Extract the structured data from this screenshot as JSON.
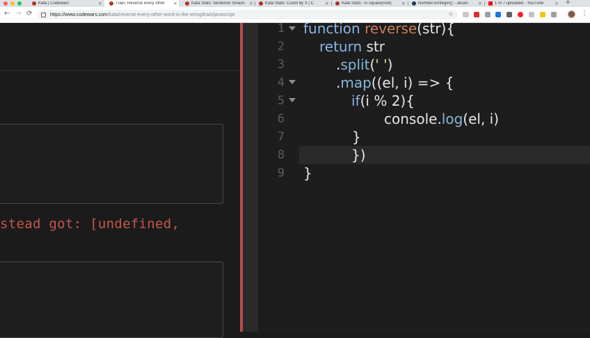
{
  "browser": {
    "tabs": [
      {
        "title": "Kata | Codewars",
        "active": false,
        "favicon_color": "#b1361e"
      },
      {
        "title": "Train: Reverse every other",
        "active": true,
        "favicon_color": "#b1361e"
      },
      {
        "title": "Kata Stats: Sentence Smash",
        "active": false,
        "favicon_color": "#b1361e"
      },
      {
        "title": "Kata Stats: Count by X | C",
        "active": false,
        "favicon_color": "#b1361e"
      },
      {
        "title": "Kata Stats: To square(root)",
        "active": false,
        "favicon_color": "#b1361e"
      },
      {
        "title": "Number.isInteger() - JavaS",
        "active": false,
        "favicon_color": "#1f3a56"
      },
      {
        "title": "1 of 7 uploaded - YouTube",
        "active": false,
        "favicon_color": "#ff0000"
      }
    ],
    "tab_close_glyph": "×",
    "new_tab_glyph": "+",
    "back_glyph": "←",
    "forward_glyph": "→",
    "reload_glyph": "⟳",
    "url_host": "https://www.codewars.com",
    "url_path": "/kata/reverse-every-other-word-in-the-string/train/javascript",
    "bookmark_glyph": "☆",
    "menu_glyph": "⋮",
    "extension_icons": [
      "media-icon",
      "extension-red-icon",
      "extension-gray-icon",
      "translate-icon",
      "extension-blue-icon",
      "opera-icon",
      "extension-gray2-icon",
      "pen-icon",
      "puzzle-icon",
      "cloud-icon"
    ]
  },
  "left_panel": {
    "error_text": "stead got: [undefined,"
  },
  "editor": {
    "lines": [
      {
        "n": "1",
        "fold": true
      },
      {
        "n": "2",
        "fold": false
      },
      {
        "n": "3",
        "fold": false
      },
      {
        "n": "4",
        "fold": true
      },
      {
        "n": "5",
        "fold": true
      },
      {
        "n": "6",
        "fold": false
      },
      {
        "n": "7",
        "fold": false
      },
      {
        "n": "8",
        "fold": false,
        "highlight": true
      },
      {
        "n": "9",
        "fold": false
      }
    ],
    "tokens": {
      "l1_kw": "function",
      "l1_fn": "reverse",
      "l1_rest": "(str){",
      "l2_kw": "return",
      "l2_rest": " str",
      "l3_dot": ".",
      "l3_mt": "split",
      "l3_open": "(",
      "l3_str": "' '",
      "l3_close": ")",
      "l4_dot": ".",
      "l4_mt": "map",
      "l4_rest": "((el, i) => {",
      "l5_kw": "if",
      "l5_rest": "(i % 2){",
      "l6_obj": "console",
      "l6_dot": ".",
      "l6_mt": "log",
      "l6_rest": "(el, i)",
      "l7": "}",
      "l8": "})",
      "l9": "}"
    }
  },
  "colors": {
    "accent_red": "#b44e46",
    "error_red": "#c8564b",
    "keyword_blue": "#8ab4e8",
    "function_orange": "#c87d5a"
  }
}
